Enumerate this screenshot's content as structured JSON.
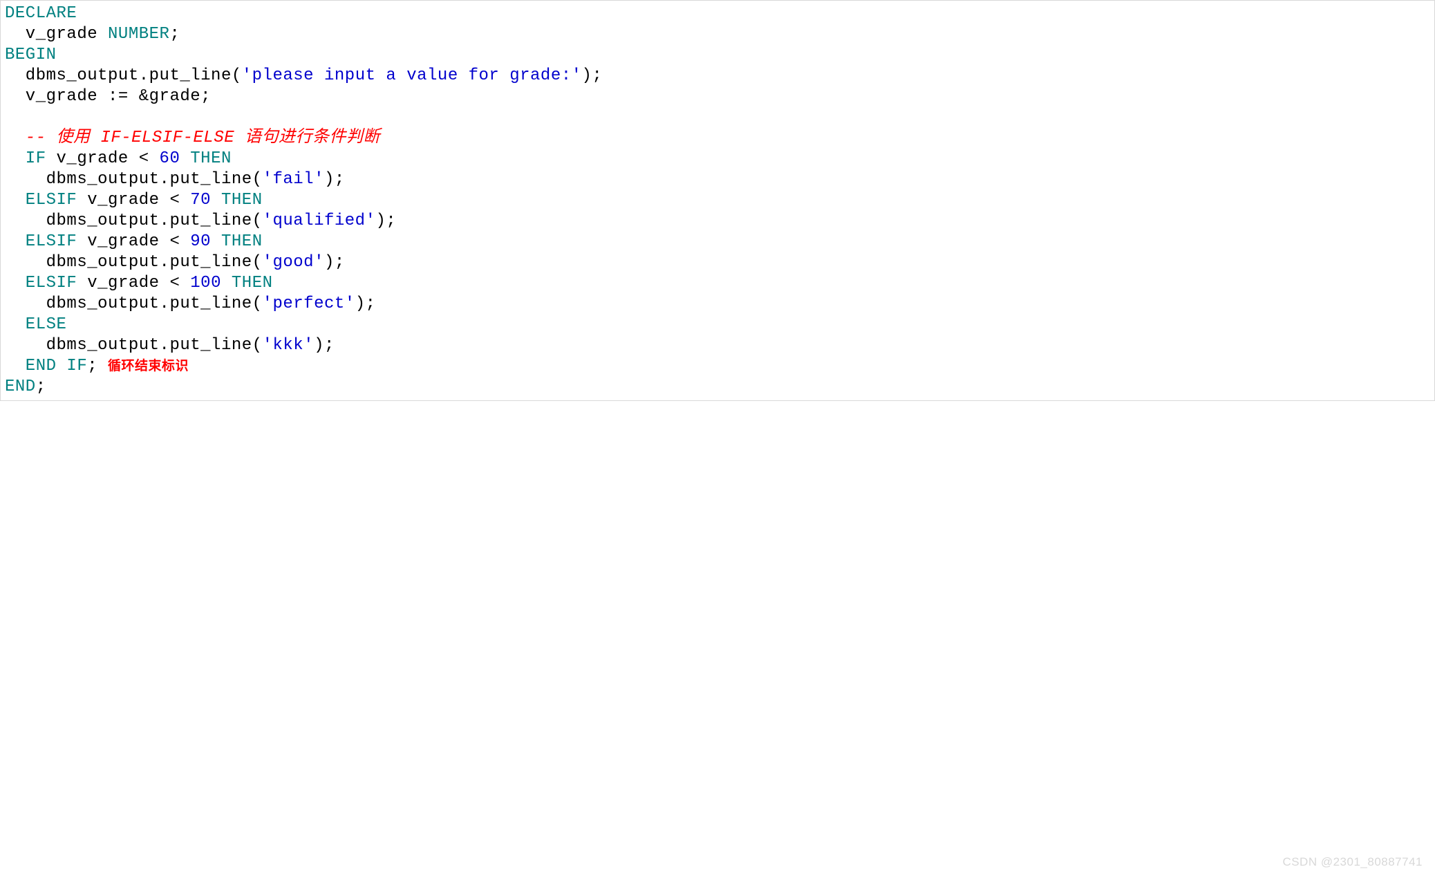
{
  "code": {
    "l1_kw": "DECLARE",
    "l2_id": "  v_grade ",
    "l2_kw": "NUMBER",
    "l2_sc": ";",
    "l3_kw": "BEGIN",
    "l4_id": "  dbms_output.put_line(",
    "l4_str": "'please input a value for grade:'",
    "l4_end": ");",
    "l5_id": "  v_grade := &grade;",
    "l6_comment": "  -- 使用 IF-ELSIF-ELSE 语句进行条件判断",
    "l7a_kw": "  IF",
    "l7b_id": " v_grade < ",
    "l7c_num": "60",
    "l7d_kw": " THEN",
    "l8_id": "    dbms_output.put_line(",
    "l8_str": "'fail'",
    "l8_end": ");",
    "l9a_kw": "  ELSIF",
    "l9b_id": " v_grade < ",
    "l9c_num": "70",
    "l9d_kw": " THEN",
    "l10_id": "    dbms_output.put_line(",
    "l10_str": "'qualified'",
    "l10_end": ");",
    "l11a_kw": "  ELSIF",
    "l11b_id": " v_grade < ",
    "l11c_num": "90",
    "l11d_kw": " THEN",
    "l12_id": "    dbms_output.put_line(",
    "l12_str": "'good'",
    "l12_end": ");",
    "l13a_kw": "  ELSIF",
    "l13b_id": " v_grade < ",
    "l13c_num": "100",
    "l13d_kw": " THEN",
    "l14_id": "    dbms_output.put_line(",
    "l14_str": "'perfect'",
    "l14_end": ");",
    "l15_kw": "  ELSE",
    "l16_id": "    dbms_output.put_line(",
    "l16_str": "'kkk'",
    "l16_end": ");",
    "l17a_kw": "  END",
    "l17b_kw": " IF",
    "l17c_sc": "; ",
    "l17_anno": "循环结束标识",
    "l18_kw": "END",
    "l18_sc": ";"
  },
  "watermark": "CSDN @2301_80887741"
}
